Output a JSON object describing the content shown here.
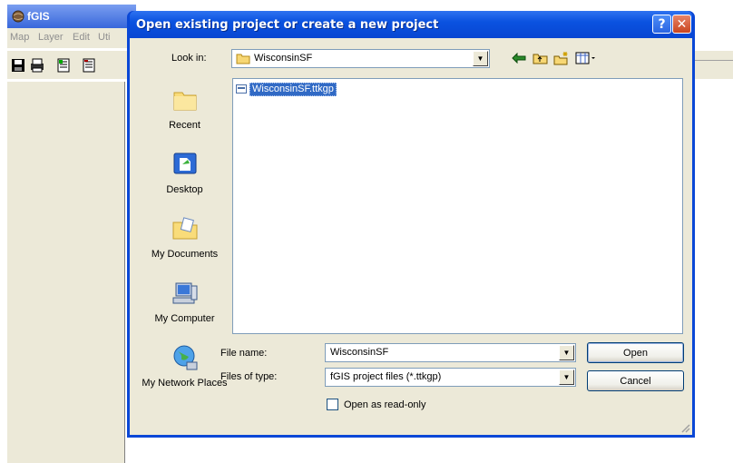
{
  "app": {
    "title": "fGIS",
    "menu": [
      "Map",
      "Layer",
      "Edit",
      "Uti"
    ]
  },
  "dialog": {
    "title": "Open existing project or create a new project",
    "help_button": "?",
    "close_button": "✕",
    "look_in_label": "Look in:",
    "look_in_value": "WisconsinSF",
    "places": [
      {
        "id": "recent",
        "label": "Recent"
      },
      {
        "id": "desktop",
        "label": "Desktop"
      },
      {
        "id": "my-documents",
        "label": "My Documents"
      },
      {
        "id": "my-computer",
        "label": "My Computer"
      },
      {
        "id": "my-network",
        "label": "My Network Places"
      }
    ],
    "files": [
      {
        "name": "WisconsinSF.ttkgp",
        "selected": true
      }
    ],
    "file_name_label": "File name:",
    "file_name_value": "WisconsinSF",
    "file_type_label": "Files of type:",
    "file_type_value": "fGIS project files (*.ttkgp)",
    "read_only_label": "Open as read-only",
    "read_only_checked": false,
    "open_button": "Open",
    "cancel_button": "Cancel"
  },
  "colors": {
    "title_bar": "#0a52e0",
    "dialog_face": "#ece9d8",
    "selection": "#316ac5"
  }
}
